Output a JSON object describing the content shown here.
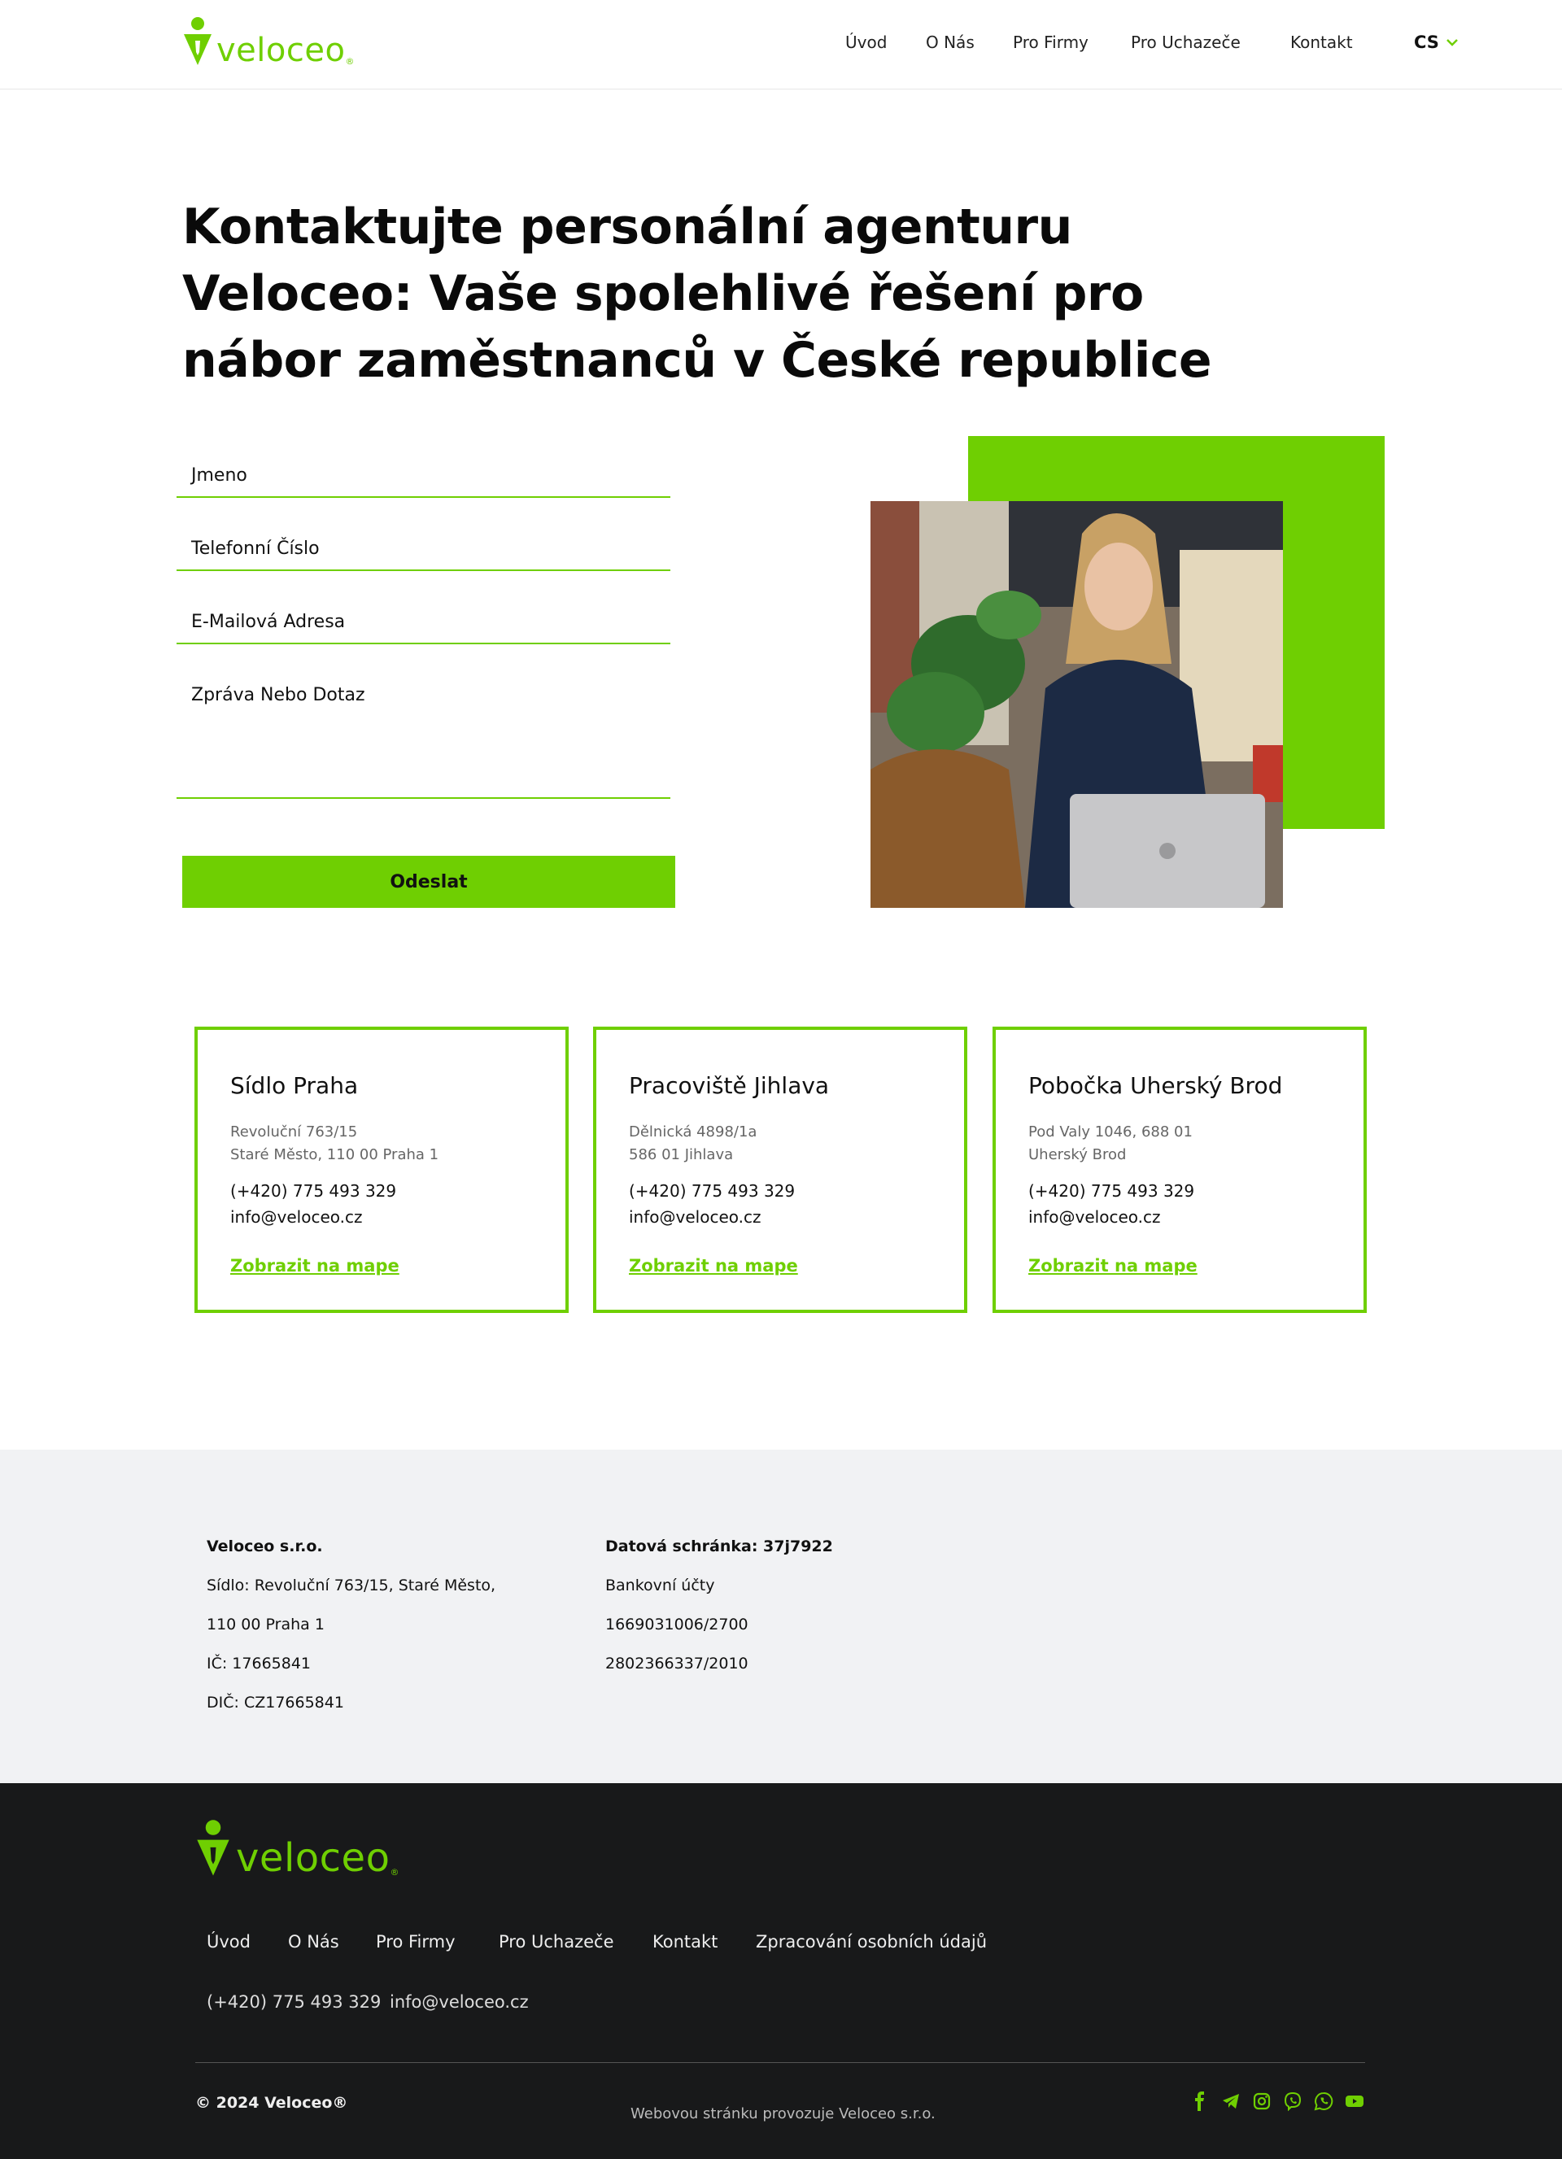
{
  "header": {
    "logo_text": "veloceo",
    "nav": [
      "Úvod",
      "O Nás",
      "Pro Firmy",
      "Pro Uchazeče",
      "Kontakt"
    ],
    "language": "CS"
  },
  "hero": {
    "title_lines": [
      "Kontaktujte personální agenturu",
      "Veloceo: Vaše spolehlivé řešení pro",
      "nábor zaměstnanců v České republice"
    ]
  },
  "form": {
    "name_label": "Jmeno",
    "phone_label": "Telefonní Číslo",
    "email_label": "E-Mailová Adresa",
    "message_label": "Zpráva Nebo Dotaz",
    "submit_label": "Odeslat"
  },
  "offices": [
    {
      "title": "Sídlo Praha",
      "address_line1": "Revoluční 763/15",
      "address_line2": "Staré Město, 110 00 Praha 1",
      "phone": "(+420) 775 493 329",
      "email": "info@veloceo.cz",
      "map_link": "Zobrazit na mape"
    },
    {
      "title": "Pracoviště Jihlava",
      "address_line1": "Dělnická 4898/1a",
      "address_line2": "586 01 Jihlava",
      "phone": "(+420) 775 493 329",
      "email": "info@veloceo.cz",
      "map_link": "Zobrazit na mape"
    },
    {
      "title": "Pobočka Uherský Brod",
      "address_line1": "Pod Valy 1046, 688 01",
      "address_line2": "Uherský Brod",
      "phone": "(+420) 775 493 329",
      "email": "info@veloceo.cz",
      "map_link": "Zobrazit na mape"
    }
  ],
  "company_info": {
    "left": {
      "name": "Veloceo s.r.o.",
      "seat_line1": "Sídlo: Revoluční 763/15, Staré Město,",
      "seat_line2": "110 00 Praha 1",
      "ico": "IČ: 17665841",
      "dic": "DIČ: CZ17665841"
    },
    "right": {
      "data_box": "Datová schránka: 37j7922",
      "bank_label": "Bankovní účty",
      "account1": "1669031006/2700",
      "account2": "2802366337/2010"
    }
  },
  "footer": {
    "logo_text": "veloceo",
    "nav": [
      "Úvod",
      "O Nás",
      "Pro Firmy",
      "Pro Uchazeče",
      "Kontakt",
      "Zpracování osobních údajů"
    ],
    "phone": "(+420) 775 493 329",
    "email": "info@veloceo.cz",
    "copyright": "© 2024 Veloceo®",
    "operated_by": "Webovou stránku provozuje Veloceo s.r.o.",
    "social_icons": [
      "facebook-icon",
      "telegram-icon",
      "instagram-icon",
      "viber-icon",
      "whatsapp-icon",
      "youtube-icon"
    ]
  },
  "colors": {
    "accent": "#6fcf02",
    "footer_bg": "#18191a",
    "info_bg": "#f1f2f4"
  }
}
